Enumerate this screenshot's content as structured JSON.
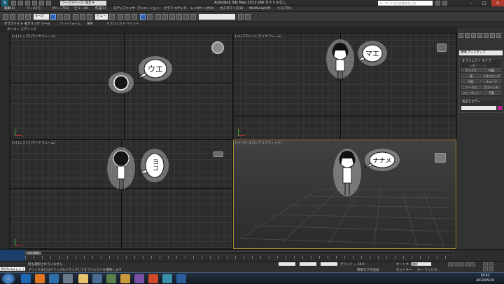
{
  "titlebar": {
    "workspace": "ワークスペース: 既定 ▾",
    "title": "Autodesk 3ds Max  2013 x64    タイトルなし",
    "search_placeholder": "キーワードまたは語句を入力",
    "window_buttons": [
      "–",
      "□",
      "✕"
    ]
  },
  "menubar": {
    "items": [
      "編集(E)",
      "ツール(T)",
      "グループ(G)",
      "ビュー(V)",
      "作成(C)",
      "モディファイヤ",
      "アニメーション",
      "グラフ エディタ",
      "レンダリング(R)",
      "カスタマイズ(U)",
      "MAXScript(M)",
      "ヘルプ(H)"
    ]
  },
  "toolbar": {
    "selection_filter": "すべて",
    "view_select": "ビュー",
    "named_selection": ""
  },
  "ribbon": {
    "tabs": [
      "グラファイト モデリング ツール",
      "フリーフォーム",
      "選択",
      "オブジェクト ペイント"
    ],
    "subtitle": "ポリゴン モデリング"
  },
  "viewports": {
    "top": "[+] [トップ] [ワイヤフレーム]",
    "front": "[+] [フロント] [ワイヤフレーム]",
    "left": "[+] [レフト] [ワイヤフレーム]",
    "perspective": "[+] [パース] [リアリスティック]"
  },
  "speech": {
    "top": "ウエ",
    "front": "マエ",
    "left": "ヨコ",
    "perspective": "ナナメ"
  },
  "command_panel": {
    "dropdown": "標準プリミティブ",
    "section_title": "オブジェクト タイプ",
    "autogrid": "自動グリッド",
    "buttons": [
      "ボックス",
      "円錐",
      "球",
      "ジオスフィア",
      "円柱",
      "チューブ",
      "トーラス",
      "ピラミッド",
      "ティーポット",
      "平面"
    ],
    "name_color": "名前とカラー",
    "color": "#c0208a"
  },
  "timeline": {
    "frame": "0 / 100",
    "ticks": [
      "0",
      "10",
      "20",
      "30",
      "40",
      "50",
      "60",
      "70",
      "80",
      "90",
      "100"
    ]
  },
  "status": {
    "maxscript": "MAXScript にようこそ",
    "none_selected": "何も選択されていません",
    "hint": "クリックまたはクリック&ドラッグしてオブジェクトを選択します",
    "grid": "グリッド = 10.0",
    "autokey": "オートキー",
    "set_key": "セットキー",
    "selected": "選択",
    "key_filter": "キー フィルタ...",
    "add_time_tag": "時間タグを追加"
  },
  "taskbar": {
    "time": "16:42",
    "date": "2012/05/39"
  }
}
